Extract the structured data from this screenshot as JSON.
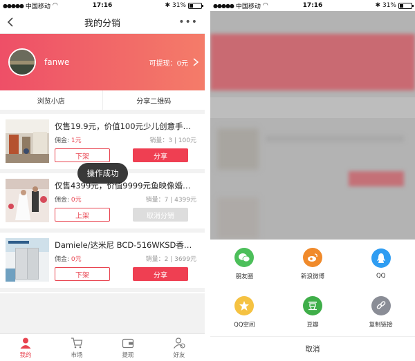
{
  "status": {
    "carrier": "中国移动",
    "time": "17:16",
    "battery": "31%"
  },
  "nav": {
    "title": "我的分销"
  },
  "banner": {
    "username": "fanwe",
    "withdraw": "可提现：0元"
  },
  "actions": {
    "browse": "浏览小店",
    "qrcode": "分享二维码"
  },
  "products": [
    {
      "name": "仅售19.9元，价值100元少儿创意手…",
      "commission_label": "佣金:",
      "commission": "1元",
      "sales": "销量：3 | 100元",
      "btn1": "下架",
      "btn2": "分享",
      "btn2_style": "filled"
    },
    {
      "name": "仅售4399元，价值9999元鱼映像婚…",
      "commission_label": "佣金:",
      "commission": "0元",
      "sales": "销量：7 | 4399元",
      "btn1": "上架",
      "btn2": "取消分销",
      "btn2_style": "disabled"
    },
    {
      "name": "Damiele/达米尼 BCD-516WKSD香…",
      "commission_label": "佣金:",
      "commission": "0元",
      "sales": "销量：2 | 3699元",
      "btn1": "下架",
      "btn2": "分享",
      "btn2_style": "filled"
    }
  ],
  "toast": "操作成功",
  "tabbar": [
    {
      "label": "我的",
      "icon": "person-icon",
      "active": true
    },
    {
      "label": "市场",
      "icon": "cart-icon",
      "active": false
    },
    {
      "label": "提现",
      "icon": "wallet-icon",
      "active": false
    },
    {
      "label": "好友",
      "icon": "friends-icon",
      "active": false
    }
  ],
  "share_sheet": {
    "items": [
      {
        "label": "朋友圈",
        "icon": "wechat-moments-icon",
        "color": "#4cbf5a"
      },
      {
        "label": "新浪微博",
        "icon": "weibo-icon",
        "color": "#f08a2b"
      },
      {
        "label": "QQ",
        "icon": "qq-icon",
        "color": "#2f9df2"
      },
      {
        "label": "QQ空间",
        "icon": "qzone-icon",
        "color": "#f5c242"
      },
      {
        "label": "豆瓣",
        "icon": "douban-icon",
        "color": "#3fae49"
      },
      {
        "label": "复制链接",
        "icon": "link-icon",
        "color": "#8a8d96"
      }
    ],
    "cancel": "取消"
  },
  "colors": {
    "accent": "#e8434f",
    "banner_start": "#ee4f67",
    "banner_end": "#f47c69"
  }
}
